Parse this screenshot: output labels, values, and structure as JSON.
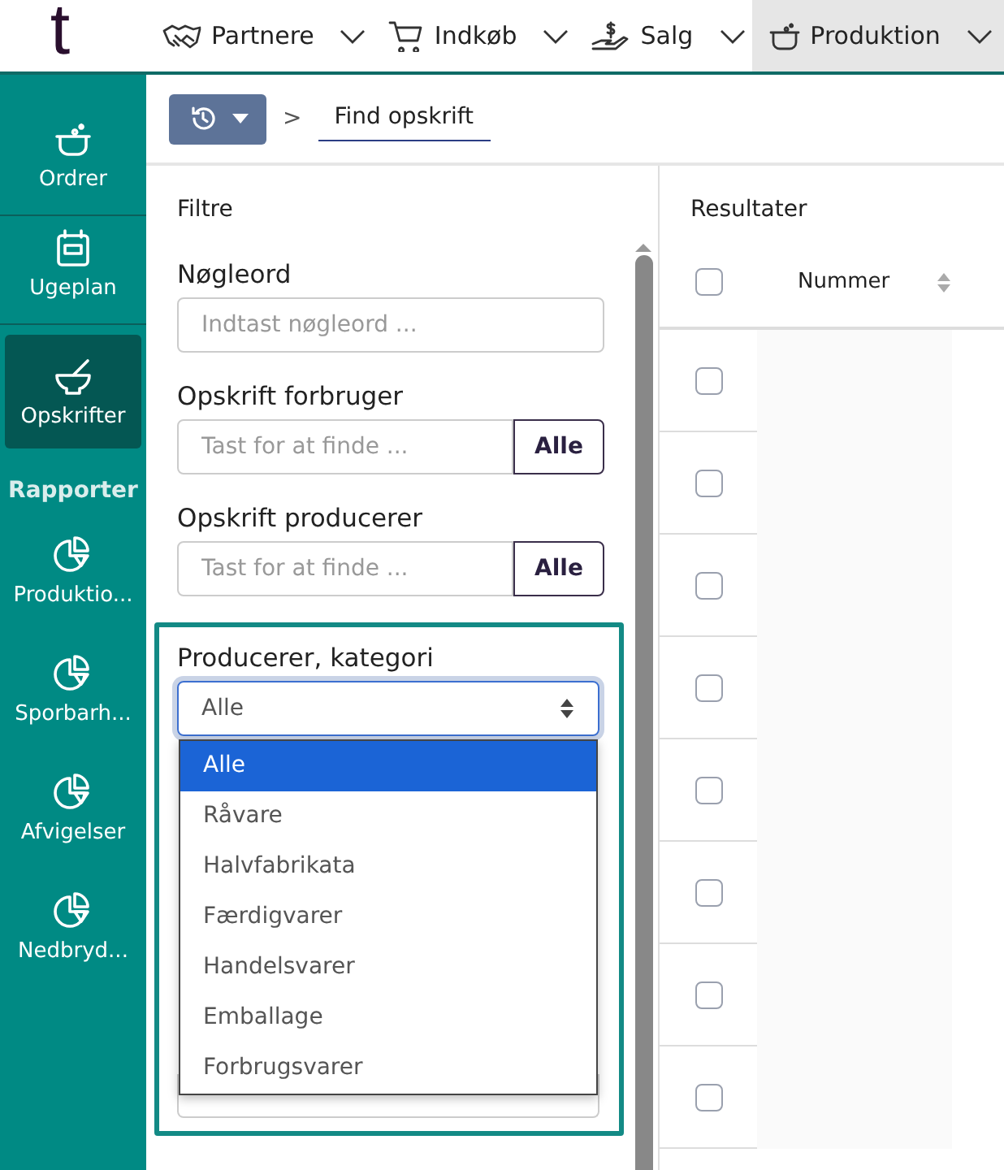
{
  "logo": "t",
  "nav": [
    {
      "label": "Partnere",
      "selected": false
    },
    {
      "label": "Indkøb",
      "selected": false
    },
    {
      "label": "Salg",
      "selected": false
    },
    {
      "label": "Produktion",
      "selected": true
    }
  ],
  "sidebar": {
    "items": [
      {
        "kind": "item",
        "label": "Ordrer",
        "selected": false
      },
      {
        "kind": "item",
        "label": "Ugeplan",
        "selected": false
      },
      {
        "kind": "item",
        "label": "Opskrifter",
        "selected": true
      },
      {
        "kind": "heading",
        "label": "Rapporter"
      },
      {
        "kind": "item",
        "label": "Produktio...",
        "selected": false
      },
      {
        "kind": "item",
        "label": "Sporbarh...",
        "selected": false
      },
      {
        "kind": "item",
        "label": "Afvigelser",
        "selected": false
      },
      {
        "kind": "item",
        "label": "Nedbryd...",
        "selected": false
      }
    ]
  },
  "breadcrumb": {
    "separator": ">",
    "current": "Find opskrift"
  },
  "filters": {
    "title": "Filtre",
    "fields": [
      {
        "kind": "text",
        "label": "Nøgleord",
        "placeholder": "Indtast nøgleord ..."
      },
      {
        "kind": "lookup",
        "label": "Opskrift forbruger",
        "placeholder": "Tast for at finde ...",
        "button": "Alle"
      },
      {
        "kind": "lookup",
        "label": "Opskrift producerer",
        "placeholder": "Tast for at finde ...",
        "button": "Alle"
      },
      {
        "kind": "select",
        "label": "Producerer, kategori",
        "value": "Alle",
        "highlighted": true,
        "options": [
          {
            "label": "Alle",
            "selected": true
          },
          {
            "label": "Råvare",
            "selected": false
          },
          {
            "label": "Halvfabrikata",
            "selected": false
          },
          {
            "label": "Færdigvarer",
            "selected": false
          },
          {
            "label": "Handelsvarer",
            "selected": false
          },
          {
            "label": "Emballage",
            "selected": false
          },
          {
            "label": "Forbrugsvarer",
            "selected": false
          }
        ]
      }
    ]
  },
  "results": {
    "title": "Resultater",
    "columns": [
      "Nummer"
    ],
    "select_all": false,
    "rows": [
      {
        "checked": false
      },
      {
        "checked": false
      },
      {
        "checked": false
      },
      {
        "checked": false
      },
      {
        "checked": false
      },
      {
        "checked": false
      },
      {
        "checked": false
      },
      {
        "checked": false
      }
    ]
  }
}
